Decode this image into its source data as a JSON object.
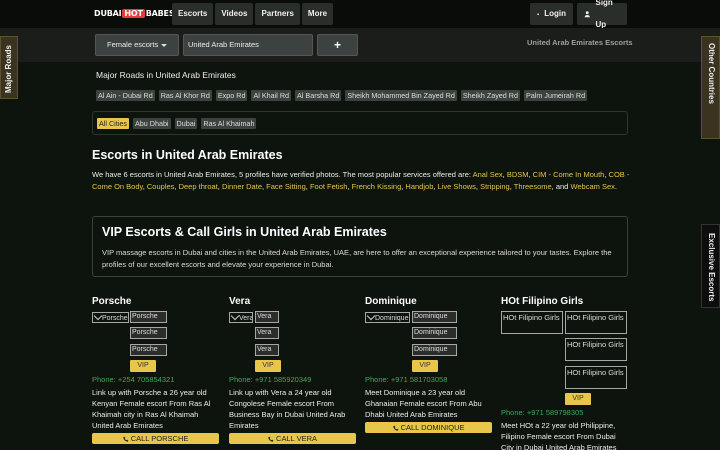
{
  "header": {
    "logo_left": "DUBAI",
    "logo_hot": "HOT",
    "logo_right": "BABES",
    "nav": [
      "Escorts",
      "Videos",
      "Partners",
      "More"
    ],
    "login": "Login",
    "signup": "Sign Up"
  },
  "filters": {
    "category": "Female escorts",
    "location": "United Arab Emirates",
    "add": "+",
    "breadcrumb": "United Arab Emirates Escorts"
  },
  "side_tabs": {
    "roads": "Major Roads",
    "countries": "Other Countries",
    "exclusive": "Exclusive Escorts"
  },
  "roads": {
    "title": "Major Roads in United Arab Emirates",
    "items": [
      "Al Ain - Dubai Rd",
      "Ras Al Khor Rd",
      "Expo Rd",
      "Al Khail Rd",
      "Al Barsha Rd",
      "Sheikh Mohammed Bin Zayed Rd",
      "Sheikh Zayed Rd",
      "Palm Jumeirah Rd"
    ]
  },
  "cities": [
    "All Cities",
    "Abu Dhabi",
    "Dubai",
    "Ras Al Khaimah"
  ],
  "main": {
    "title": "Escorts in United Arab Emirates",
    "intro_lead": "We have 6 escorts in United Arab Emirates, 5 profiles have verified photos. The most popular services offered are: ",
    "services": [
      "Anal Sex",
      "BDSM",
      "CIM - Come In Mouth",
      "COB - Come On Body",
      "Couples",
      "Deep throat",
      "Dinner Date",
      "Face Sitting",
      "Foot Fetish",
      "French Kissing",
      "Handjob",
      "Live Shows",
      "Stripping",
      "Threesome",
      "Webcam Sex"
    ]
  },
  "vip": {
    "title": "VIP Escorts & Call Girls in United Arab Emirates",
    "text": "VIP massage escorts in Dubai and cities in the United Arab Emirates, UAE, are here to offer an exceptional experience tailored to your tastes. Explore the profiles of our excellent escorts and elevate your experience in Dubai."
  },
  "cards": [
    {
      "name": "Porsche",
      "img_alt": "Porsche",
      "vip": "VIP",
      "phone": "Phone: +254 705854321",
      "desc": "Link up with Porsche a 26 year old Kenyan Female escort From Ras Al Khaimah city in Ras Al Khaimah United Arab Emirates",
      "call": "CALL PORSCHE"
    },
    {
      "name": "Vera",
      "img_alt": "Vera",
      "vip": "VIP",
      "phone": "Phone: +971 585920349",
      "desc": "Link up with Vera a 24 year old Congolese Female escort From Business Bay in Dubai United Arab Emirates",
      "call": "CALL VERA"
    },
    {
      "name": "Dominique",
      "img_alt": "Dominique",
      "vip": "VIP",
      "phone": "Phone: +971 581703058",
      "desc": "Meet Dominique a 23 year old Ghanaian Female escort From Abu Dhabi United Arab Emirates",
      "call": "CALL DOMINIQUE"
    },
    {
      "name": "HOt Filipino Girls",
      "img_alt": "HOt Filipino Girls",
      "vip": "VIP",
      "phone": "Phone: +971 589798305",
      "desc": "Meet HOt a 22 year old Philippine, Filipino Female escort From Dubai City in Dubai United Arab Emirates"
    }
  ],
  "colors": {
    "accent": "#e8c64a",
    "phone": "#3fa85a",
    "background": "#0d130d"
  }
}
